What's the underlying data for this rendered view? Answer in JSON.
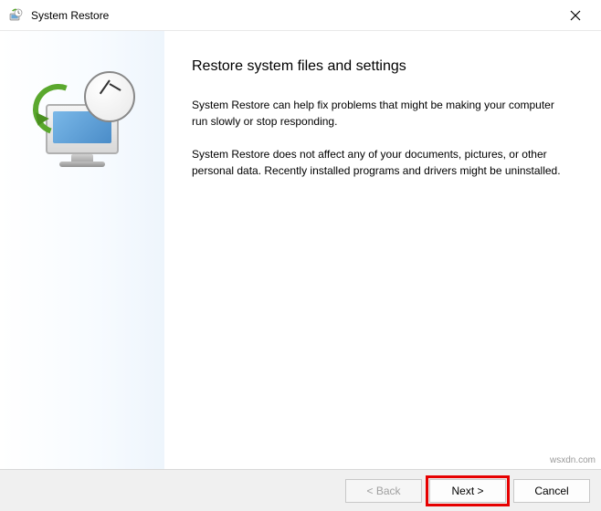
{
  "titlebar": {
    "title": "System Restore"
  },
  "main": {
    "heading": "Restore system files and settings",
    "para1": "System Restore can help fix problems that might be making your computer run slowly or stop responding.",
    "para2": "System Restore does not affect any of your documents, pictures, or other personal data. Recently installed programs and drivers might be uninstalled."
  },
  "footer": {
    "back": "< Back",
    "next": "Next >",
    "cancel": "Cancel"
  },
  "watermark": "wsxdn.com"
}
